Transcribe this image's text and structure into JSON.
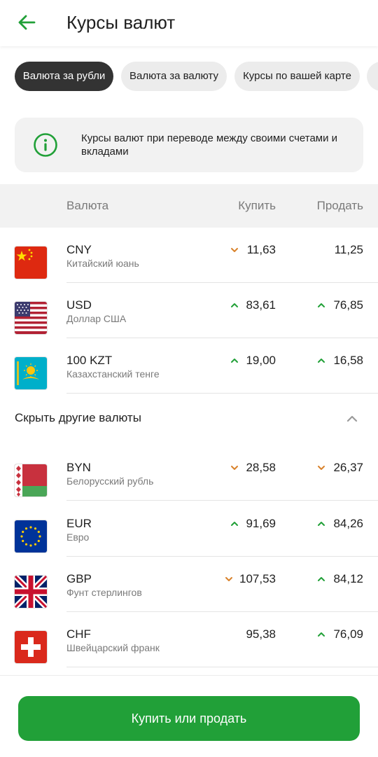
{
  "header": {
    "title": "Курсы валют",
    "back_icon": "arrow-left-icon",
    "accent": "#21a038"
  },
  "tabs": [
    {
      "label": "Валюта за рубли",
      "active": true
    },
    {
      "label": "Валюта за валюту",
      "active": false
    },
    {
      "label": "Курсы по вашей карте",
      "active": false
    }
  ],
  "info": {
    "icon": "info-icon",
    "text": "Курсы валют при переводе между своими счетами и вкладами"
  },
  "table": {
    "headers": {
      "currency": "Валюта",
      "buy": "Купить",
      "sell": "Продать"
    },
    "rows": [
      {
        "code": "CNY",
        "name": "Китайский юань",
        "buy": "11,63",
        "buy_trend": "down",
        "sell": "11,25",
        "sell_trend": "none",
        "flag": "china-flag-icon"
      },
      {
        "code": "USD",
        "name": "Доллар США",
        "buy": "83,61",
        "buy_trend": "up",
        "sell": "76,85",
        "sell_trend": "up",
        "flag": "usa-flag-icon"
      },
      {
        "code": "100 KZT",
        "name": "Казахстанский тенге",
        "buy": "19,00",
        "buy_trend": "up",
        "sell": "16,58",
        "sell_trend": "up",
        "flag": "kazakhstan-flag-icon"
      }
    ],
    "toggle": {
      "label": "Скрыть другие валюты",
      "icon": "chevron-up-icon"
    },
    "other_rows": [
      {
        "code": "BYN",
        "name": "Белорусский рубль",
        "buy": "28,58",
        "buy_trend": "down",
        "sell": "26,37",
        "sell_trend": "down",
        "flag": "belarus-flag-icon"
      },
      {
        "code": "EUR",
        "name": "Евро",
        "buy": "91,69",
        "buy_trend": "up",
        "sell": "84,26",
        "sell_trend": "up",
        "flag": "eu-flag-icon"
      },
      {
        "code": "GBP",
        "name": "Фунт стерлингов",
        "buy": "107,53",
        "buy_trend": "down",
        "sell": "84,12",
        "sell_trend": "up",
        "flag": "uk-flag-icon"
      },
      {
        "code": "CHF",
        "name": "Швейцарский франк",
        "buy": "95,38",
        "buy_trend": "none",
        "sell": "76,09",
        "sell_trend": "up",
        "flag": "switzerland-flag-icon"
      }
    ]
  },
  "trend_colors": {
    "up": "#21a038",
    "down": "#d9822b"
  },
  "cta": {
    "label": "Купить или продать"
  }
}
